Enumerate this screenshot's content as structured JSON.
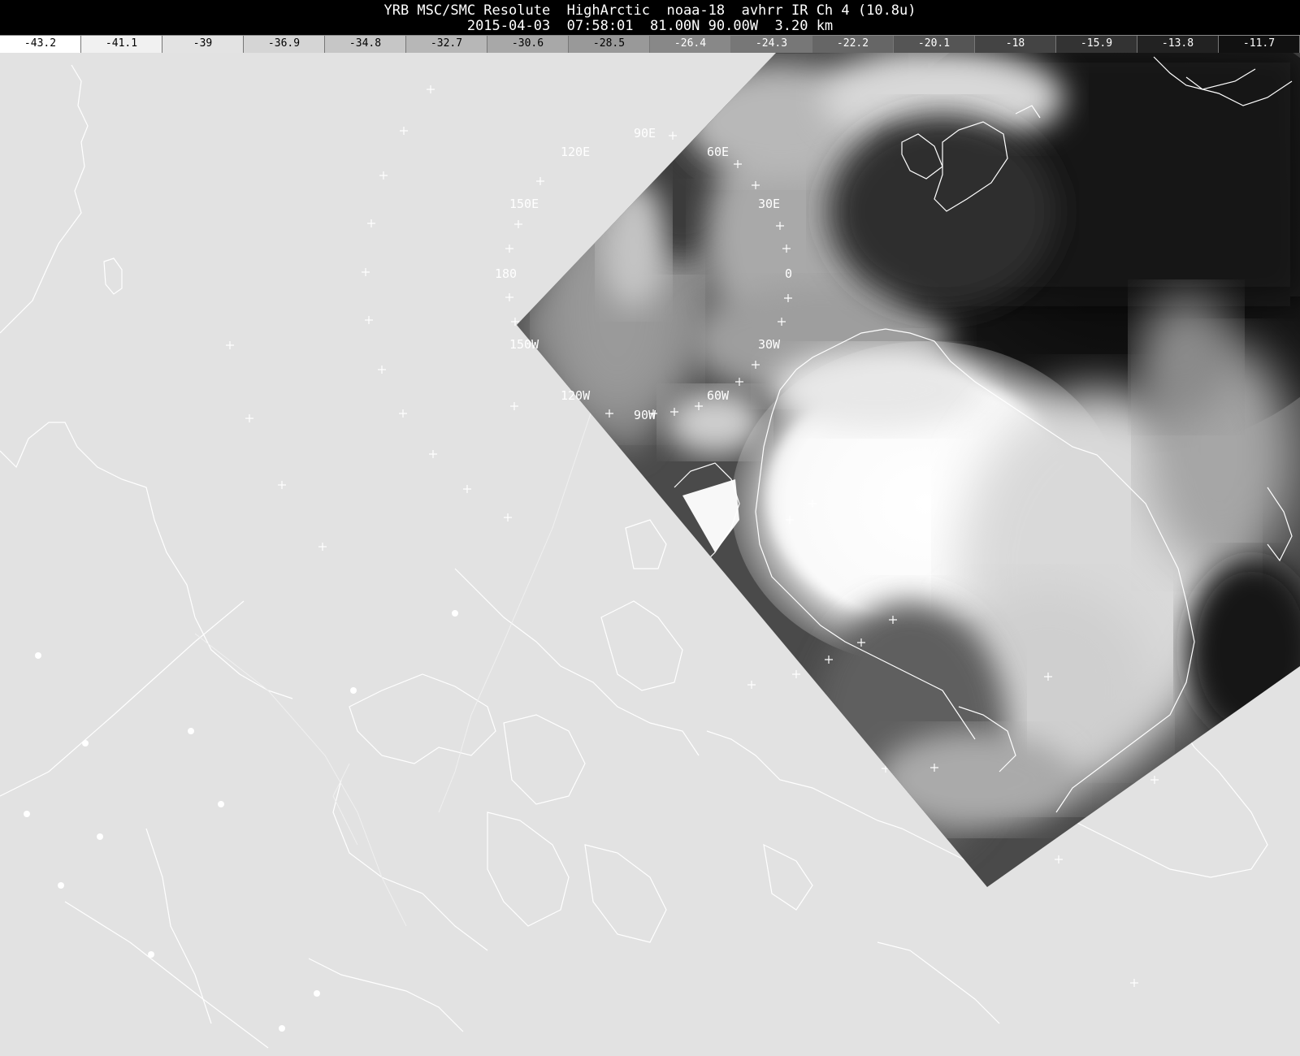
{
  "header": {
    "line1": "YRB MSC/SMC Resolute  HighArctic  noaa-18  avhrr IR Ch 4 (10.8u)",
    "line2": "2015-04-03  07:58:01  81.00N 90.00W  3.20 km"
  },
  "colorbar": {
    "labels": [
      "-43.2",
      "-41.1",
      "-39",
      "-36.9",
      "-34.8",
      "-32.7",
      "-30.6",
      "-28.5",
      "-26.4",
      "-24.3",
      "-22.2",
      "-20.1",
      "-18",
      "-15.9",
      "-13.8",
      "-11.7"
    ],
    "colors": [
      "#ffffff",
      "#f1f1f1",
      "#e3e3e3",
      "#d5d5d5",
      "#c6c6c6",
      "#b7b7b7",
      "#a8a8a8",
      "#999999",
      "#888888",
      "#777777",
      "#666666",
      "#555555",
      "#444444",
      "#333333",
      "#222222",
      "#111111"
    ]
  },
  "map": {
    "background_color": "#e2e2e2",
    "graticule_labels": [
      "90E",
      "120E",
      "60E",
      "150E",
      "30E",
      "180",
      "0",
      "150W",
      "30W",
      "120W",
      "60W",
      "90W"
    ]
  },
  "colors": {
    "coastline": "#ffffff",
    "background": "#000000",
    "text": "#ffffff"
  }
}
